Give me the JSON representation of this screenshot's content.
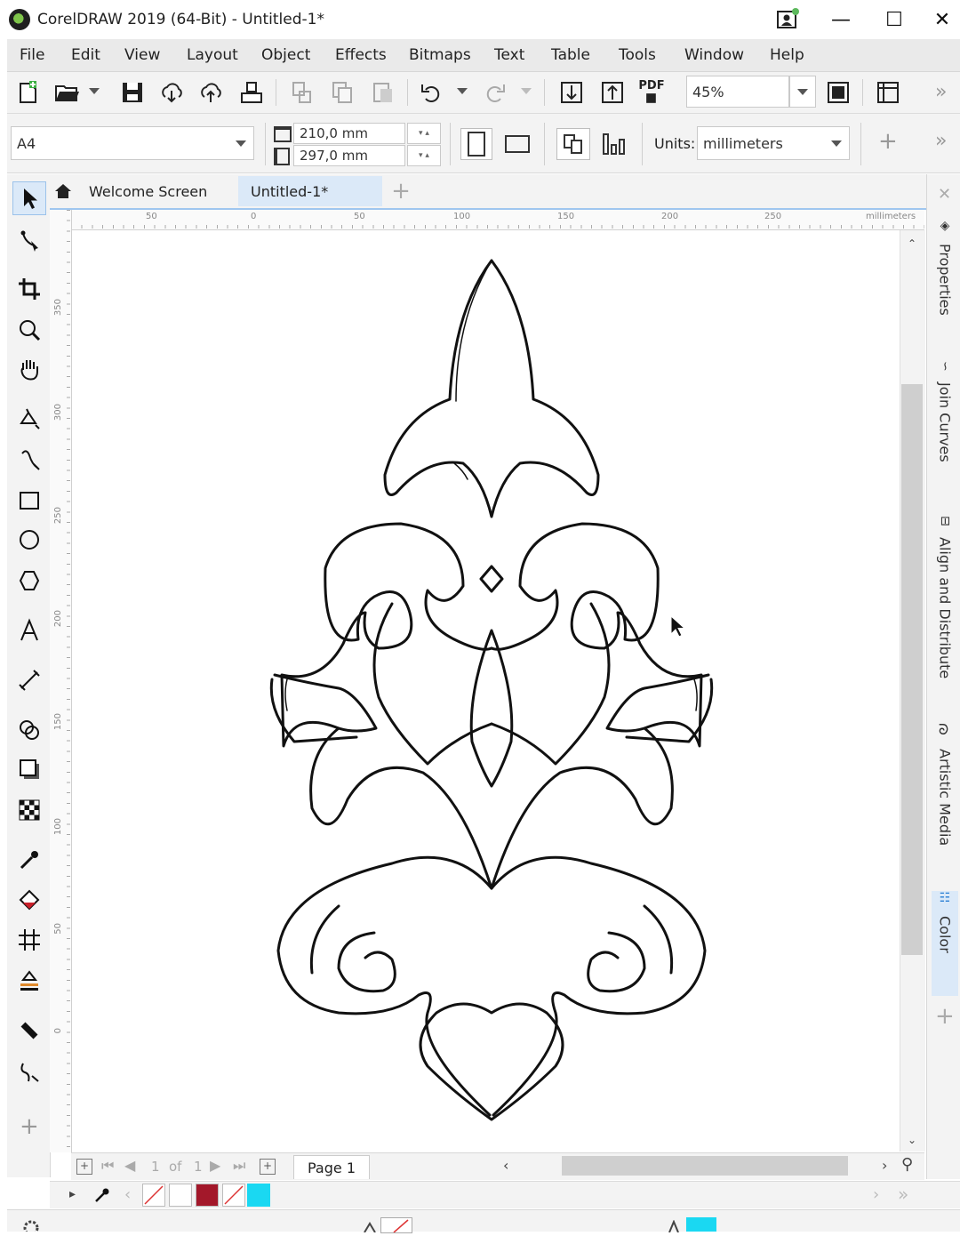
{
  "window": {
    "title": "CorelDRAW 2019 (64-Bit) - Untitled-1*",
    "controls": {
      "minimize": "—",
      "maximize": "☐",
      "close": "✕"
    }
  },
  "menu": [
    {
      "label": "File"
    },
    {
      "label": "Edit"
    },
    {
      "label": "View"
    },
    {
      "label": "Layout"
    },
    {
      "label": "Object"
    },
    {
      "label": "Effects"
    },
    {
      "label": "Bitmaps"
    },
    {
      "label": "Text"
    },
    {
      "label": "Table"
    },
    {
      "label": "Tools"
    },
    {
      "label": "Window"
    },
    {
      "label": "Help"
    }
  ],
  "standard_toolbar": {
    "pdf_label": "PDF",
    "zoom_value": "45%",
    "overflow": "»"
  },
  "property_bar": {
    "page_size": "A4",
    "width": "210,0 mm",
    "height": "297,0 mm",
    "units_label": "Units:",
    "units_value": "millimeters",
    "add_label": "+",
    "overflow": "»"
  },
  "tabs": {
    "welcome": "Welcome Screen",
    "document": "Untitled-1*",
    "add": "+"
  },
  "ruler": {
    "h_labels": [
      "50",
      "0",
      "50",
      "100",
      "150",
      "200",
      "250"
    ],
    "unit": "millimeters",
    "v_labels": [
      "350",
      "300",
      "250",
      "200",
      "150",
      "100",
      "50",
      "0"
    ]
  },
  "dockers": [
    {
      "label": "Properties",
      "icon": "properties-icon"
    },
    {
      "label": "Join Curves",
      "icon": "join-curves-icon"
    },
    {
      "label": "Align and Distribute",
      "icon": "align-icon"
    },
    {
      "label": "Artistic Media",
      "icon": "artistic-media-icon"
    },
    {
      "label": "Color",
      "icon": "color-icon"
    }
  ],
  "page_nav": {
    "current": "1",
    "of_label": "of",
    "total": "1",
    "page_tab": "Page 1"
  },
  "palette": {
    "swatches": [
      "#ffffff",
      "#a3182a",
      "#1ad8f2"
    ]
  },
  "colors": {
    "accent": "#9fc6ef",
    "fill_swatch": "#a3182a",
    "outline_swatch": "#1ad8f2"
  }
}
